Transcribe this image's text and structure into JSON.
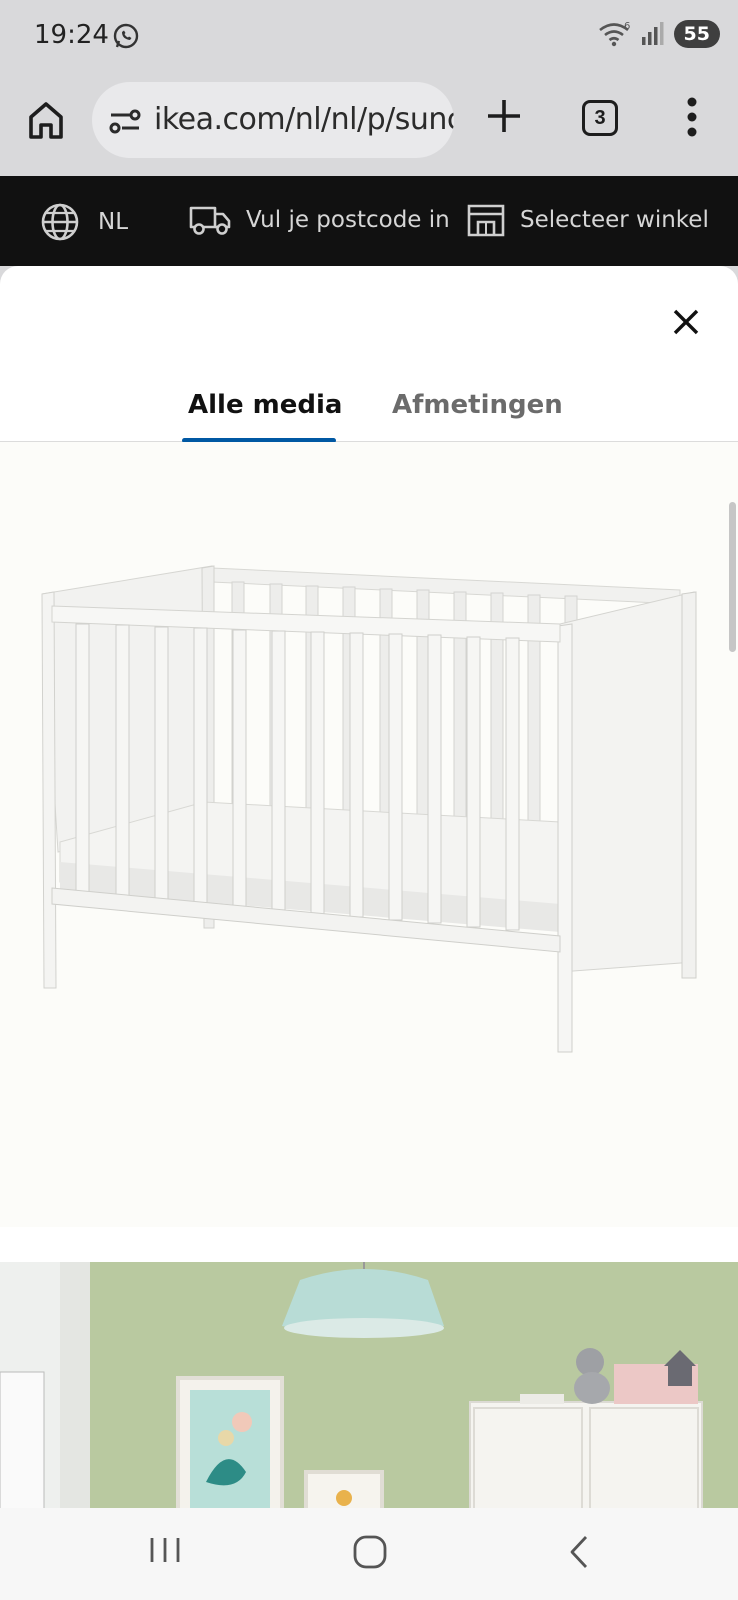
{
  "status": {
    "time": "19:24",
    "battery": "55",
    "wifi_badge": "6"
  },
  "browser": {
    "url": "ikea.com/nl/nl/p/sunc",
    "tab_count": "3"
  },
  "ikea_bar": {
    "language": "NL",
    "postcode": "Vul je postcode in",
    "store": "Selecteer winkel"
  },
  "modal": {
    "tabs": [
      {
        "label": "Alle media",
        "active": true
      },
      {
        "label": "Afmetingen",
        "active": false
      }
    ]
  },
  "colors": {
    "accent": "#0058a3",
    "ikea_bar_bg": "#111111",
    "chrome_bg": "#d9d9db"
  },
  "icons": [
    "whatsapp-icon",
    "wifi-icon",
    "signal-icon",
    "home-icon",
    "tune-icon",
    "plus-icon",
    "tabs-icon",
    "more-vert-icon",
    "globe-icon",
    "truck-icon",
    "store-icon",
    "close-icon",
    "recents-icon",
    "home-nav-icon",
    "back-icon"
  ]
}
